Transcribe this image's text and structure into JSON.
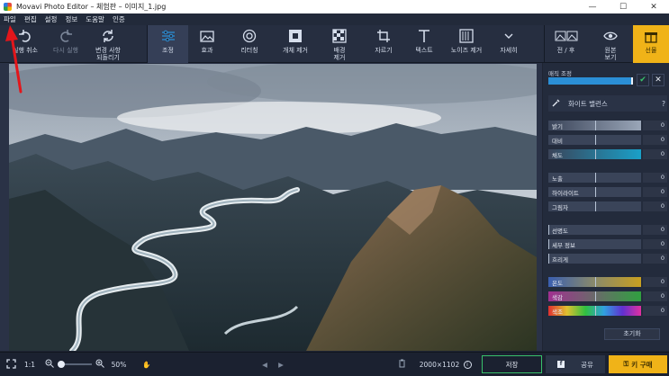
{
  "window": {
    "title": "Movavi Photo Editor – 체험판 – 이미지_1.jpg"
  },
  "menu": [
    "파일",
    "편집",
    "설정",
    "정보",
    "도움말",
    "인증"
  ],
  "toolbar": {
    "undo": "실행 취소",
    "redo": "다시 실행",
    "reset_bg": "변경 사항\n되돌리기",
    "adjust": "조정",
    "effects": "효과",
    "retouch": "리터칭",
    "object_removal": "개체 제거",
    "background": "배경\n제거",
    "crop": "자르기",
    "text": "텍스트",
    "denoise": "노이즈 제거",
    "more": "자세히",
    "before_after": "전 / 후",
    "original": "원본\n보기",
    "gift": "선물"
  },
  "panel": {
    "magic": "매직 조정",
    "white_balance": "화이트 밸런스",
    "help": "?",
    "group1": [
      {
        "label": "밝기",
        "value": "0"
      },
      {
        "label": "대비",
        "value": "0"
      },
      {
        "label": "채도",
        "value": "0"
      }
    ],
    "group2": [
      {
        "label": "노출",
        "value": "0"
      },
      {
        "label": "하이라이트",
        "value": "0"
      },
      {
        "label": "그림자",
        "value": "0"
      }
    ],
    "group3": [
      {
        "label": "선명도",
        "value": "0"
      },
      {
        "label": "세부 정보",
        "value": "0"
      },
      {
        "label": "흐리게",
        "value": "0"
      }
    ],
    "group4": [
      {
        "label": "온도",
        "value": "0"
      },
      {
        "label": "색감",
        "value": "0"
      },
      {
        "label": "색조",
        "value": "0"
      }
    ],
    "reset": "초기화"
  },
  "bottom": {
    "ratio": "1:1",
    "zoom": "50%",
    "resolution": "2000×1102",
    "save": "저장",
    "share": "공유",
    "buy": "키 구매"
  },
  "colors": {
    "accent": "#2b8fd6",
    "buy": "#f0b318",
    "annotation": "#e3161b"
  }
}
